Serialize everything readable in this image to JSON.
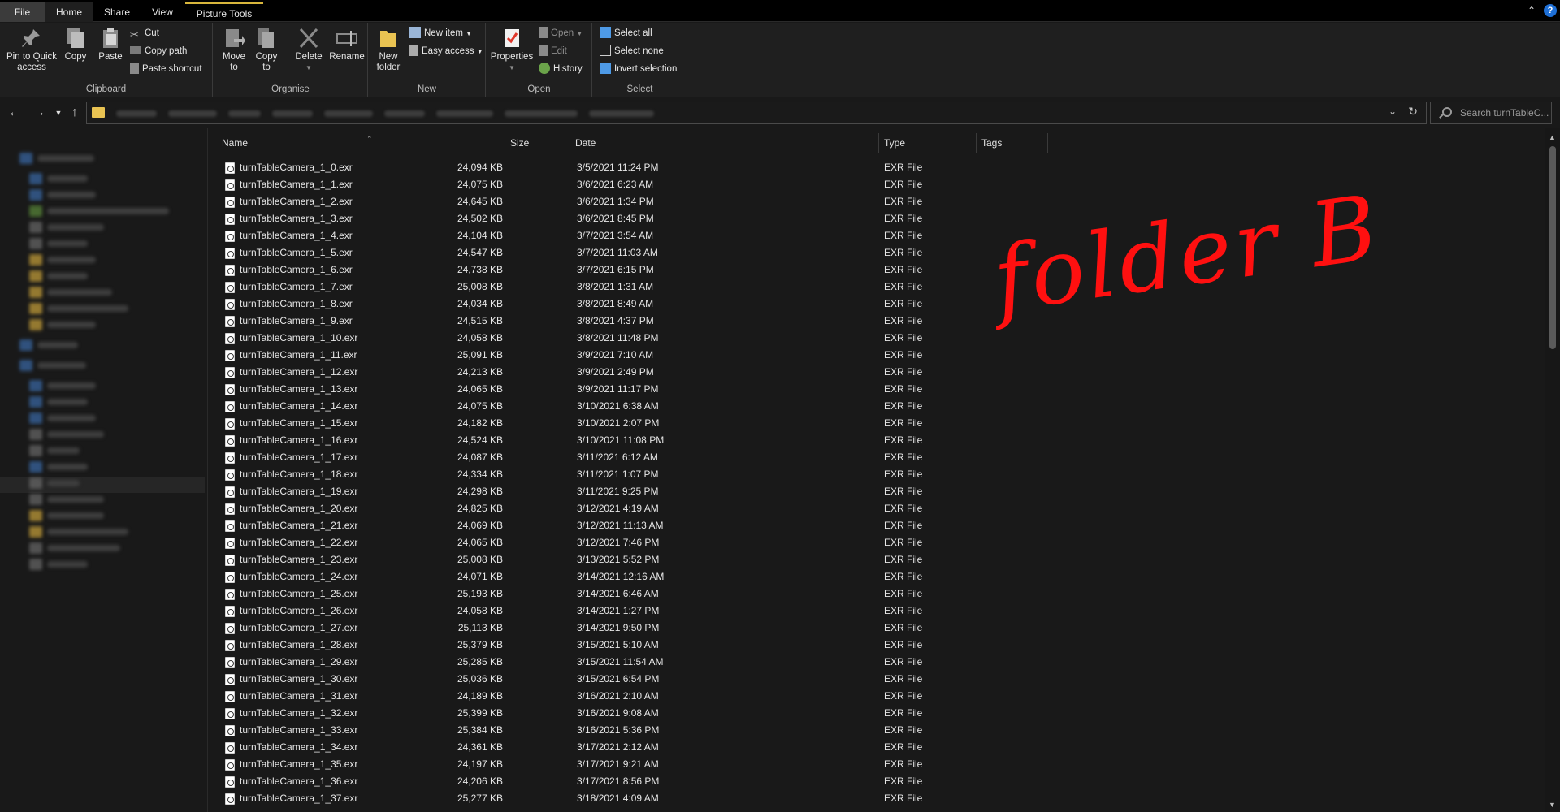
{
  "tabs": {
    "file": "File",
    "home": "Home",
    "share": "Share",
    "view": "View",
    "picture_tools": "Picture Tools"
  },
  "ribbon": {
    "clipboard": {
      "label": "Clipboard",
      "pin": "Pin to Quick access",
      "copy": "Copy",
      "paste": "Paste",
      "cut": "Cut",
      "copy_path": "Copy path",
      "paste_shortcut": "Paste shortcut"
    },
    "organise": {
      "label": "Organise",
      "move_to": "Move to",
      "copy_to": "Copy to",
      "delete": "Delete",
      "rename": "Rename"
    },
    "new": {
      "label": "New",
      "new_folder": "New folder",
      "new_item": "New item",
      "easy_access": "Easy access"
    },
    "open": {
      "label": "Open",
      "properties": "Properties",
      "open": "Open",
      "edit": "Edit",
      "history": "History"
    },
    "select": {
      "label": "Select",
      "select_all": "Select all",
      "select_none": "Select none",
      "invert_selection": "Invert selection"
    }
  },
  "search": {
    "placeholder": "Search turnTableC..."
  },
  "columns": {
    "name": "Name",
    "size": "Size",
    "date": "Date",
    "type": "Type",
    "tags": "Tags"
  },
  "files": [
    {
      "name": "turnTableCamera_1_0.exr",
      "size": "24,094 KB",
      "date": "3/5/2021 11:24 PM",
      "type": "EXR File"
    },
    {
      "name": "turnTableCamera_1_1.exr",
      "size": "24,075 KB",
      "date": "3/6/2021 6:23 AM",
      "type": "EXR File"
    },
    {
      "name": "turnTableCamera_1_2.exr",
      "size": "24,645 KB",
      "date": "3/6/2021 1:34 PM",
      "type": "EXR File"
    },
    {
      "name": "turnTableCamera_1_3.exr",
      "size": "24,502 KB",
      "date": "3/6/2021 8:45 PM",
      "type": "EXR File"
    },
    {
      "name": "turnTableCamera_1_4.exr",
      "size": "24,104 KB",
      "date": "3/7/2021 3:54 AM",
      "type": "EXR File"
    },
    {
      "name": "turnTableCamera_1_5.exr",
      "size": "24,547 KB",
      "date": "3/7/2021 11:03 AM",
      "type": "EXR File"
    },
    {
      "name": "turnTableCamera_1_6.exr",
      "size": "24,738 KB",
      "date": "3/7/2021 6:15 PM",
      "type": "EXR File"
    },
    {
      "name": "turnTableCamera_1_7.exr",
      "size": "25,008 KB",
      "date": "3/8/2021 1:31 AM",
      "type": "EXR File"
    },
    {
      "name": "turnTableCamera_1_8.exr",
      "size": "24,034 KB",
      "date": "3/8/2021 8:49 AM",
      "type": "EXR File"
    },
    {
      "name": "turnTableCamera_1_9.exr",
      "size": "24,515 KB",
      "date": "3/8/2021 4:37 PM",
      "type": "EXR File"
    },
    {
      "name": "turnTableCamera_1_10.exr",
      "size": "24,058 KB",
      "date": "3/8/2021 11:48 PM",
      "type": "EXR File"
    },
    {
      "name": "turnTableCamera_1_11.exr",
      "size": "25,091 KB",
      "date": "3/9/2021 7:10 AM",
      "type": "EXR File"
    },
    {
      "name": "turnTableCamera_1_12.exr",
      "size": "24,213 KB",
      "date": "3/9/2021 2:49 PM",
      "type": "EXR File"
    },
    {
      "name": "turnTableCamera_1_13.exr",
      "size": "24,065 KB",
      "date": "3/9/2021 11:17 PM",
      "type": "EXR File"
    },
    {
      "name": "turnTableCamera_1_14.exr",
      "size": "24,075 KB",
      "date": "3/10/2021 6:38 AM",
      "type": "EXR File"
    },
    {
      "name": "turnTableCamera_1_15.exr",
      "size": "24,182 KB",
      "date": "3/10/2021 2:07 PM",
      "type": "EXR File"
    },
    {
      "name": "turnTableCamera_1_16.exr",
      "size": "24,524 KB",
      "date": "3/10/2021 11:08 PM",
      "type": "EXR File"
    },
    {
      "name": "turnTableCamera_1_17.exr",
      "size": "24,087 KB",
      "date": "3/11/2021 6:12 AM",
      "type": "EXR File"
    },
    {
      "name": "turnTableCamera_1_18.exr",
      "size": "24,334 KB",
      "date": "3/11/2021 1:07 PM",
      "type": "EXR File"
    },
    {
      "name": "turnTableCamera_1_19.exr",
      "size": "24,298 KB",
      "date": "3/11/2021 9:25 PM",
      "type": "EXR File"
    },
    {
      "name": "turnTableCamera_1_20.exr",
      "size": "24,825 KB",
      "date": "3/12/2021 4:19 AM",
      "type": "EXR File"
    },
    {
      "name": "turnTableCamera_1_21.exr",
      "size": "24,069 KB",
      "date": "3/12/2021 11:13 AM",
      "type": "EXR File"
    },
    {
      "name": "turnTableCamera_1_22.exr",
      "size": "24,065 KB",
      "date": "3/12/2021 7:46 PM",
      "type": "EXR File"
    },
    {
      "name": "turnTableCamera_1_23.exr",
      "size": "25,008 KB",
      "date": "3/13/2021 5:52 PM",
      "type": "EXR File"
    },
    {
      "name": "turnTableCamera_1_24.exr",
      "size": "24,071 KB",
      "date": "3/14/2021 12:16 AM",
      "type": "EXR File"
    },
    {
      "name": "turnTableCamera_1_25.exr",
      "size": "25,193 KB",
      "date": "3/14/2021 6:46 AM",
      "type": "EXR File"
    },
    {
      "name": "turnTableCamera_1_26.exr",
      "size": "24,058 KB",
      "date": "3/14/2021 1:27 PM",
      "type": "EXR File"
    },
    {
      "name": "turnTableCamera_1_27.exr",
      "size": "25,113 KB",
      "date": "3/14/2021 9:50 PM",
      "type": "EXR File"
    },
    {
      "name": "turnTableCamera_1_28.exr",
      "size": "25,379 KB",
      "date": "3/15/2021 5:10 AM",
      "type": "EXR File"
    },
    {
      "name": "turnTableCamera_1_29.exr",
      "size": "25,285 KB",
      "date": "3/15/2021 11:54 AM",
      "type": "EXR File"
    },
    {
      "name": "turnTableCamera_1_30.exr",
      "size": "25,036 KB",
      "date": "3/15/2021 6:54 PM",
      "type": "EXR File"
    },
    {
      "name": "turnTableCamera_1_31.exr",
      "size": "24,189 KB",
      "date": "3/16/2021 2:10 AM",
      "type": "EXR File"
    },
    {
      "name": "turnTableCamera_1_32.exr",
      "size": "25,399 KB",
      "date": "3/16/2021 9:08 AM",
      "type": "EXR File"
    },
    {
      "name": "turnTableCamera_1_33.exr",
      "size": "25,384 KB",
      "date": "3/16/2021 5:36 PM",
      "type": "EXR File"
    },
    {
      "name": "turnTableCamera_1_34.exr",
      "size": "24,361 KB",
      "date": "3/17/2021 2:12 AM",
      "type": "EXR File"
    },
    {
      "name": "turnTableCamera_1_35.exr",
      "size": "24,197 KB",
      "date": "3/17/2021 9:21 AM",
      "type": "EXR File"
    },
    {
      "name": "turnTableCamera_1_36.exr",
      "size": "24,206 KB",
      "date": "3/17/2021 8:56 PM",
      "type": "EXR File"
    },
    {
      "name": "turnTableCamera_1_37.exr",
      "size": "25,277 KB",
      "date": "3/18/2021 4:09 AM",
      "type": "EXR File"
    }
  ],
  "annotation": "folder B",
  "colors": {
    "accent_tab": "#d8b63c",
    "annotation": "#ff1010",
    "background": "#191919"
  }
}
